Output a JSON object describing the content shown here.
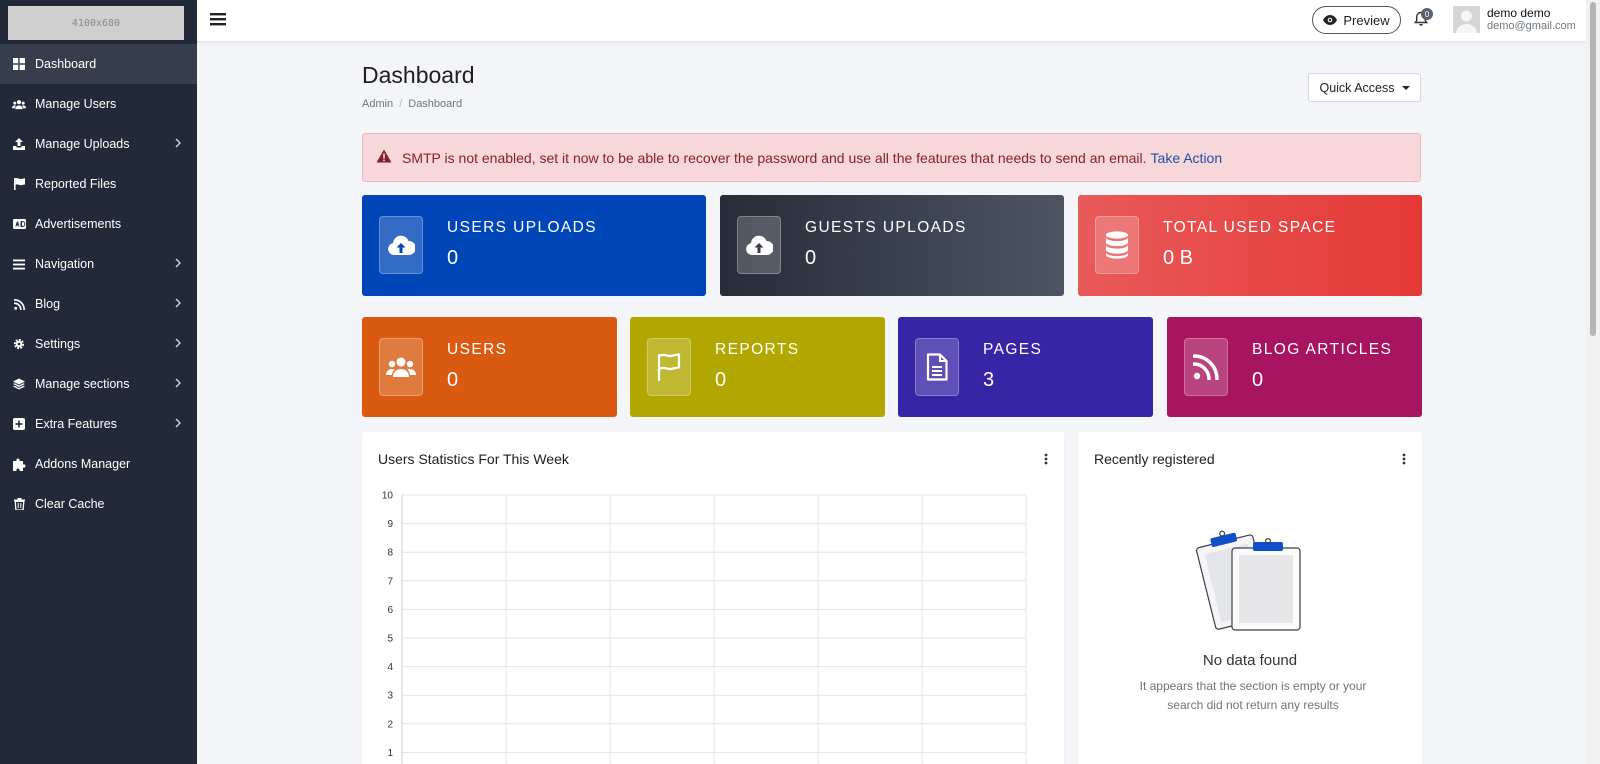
{
  "brand": {
    "logo_text": "4100x680"
  },
  "sidebar": {
    "items": [
      {
        "label": "Dashboard",
        "icon": "dashboard-icon",
        "chevron": false,
        "active": true
      },
      {
        "label": "Manage Users",
        "icon": "users-icon",
        "chevron": false
      },
      {
        "label": "Manage Uploads",
        "icon": "upload-icon",
        "chevron": true
      },
      {
        "label": "Reported Files",
        "icon": "flag-icon",
        "chevron": false
      },
      {
        "label": "Advertisements",
        "icon": "ad-icon",
        "chevron": false
      },
      {
        "label": "Navigation",
        "icon": "bars-icon",
        "chevron": true
      },
      {
        "label": "Blog",
        "icon": "rss-icon",
        "chevron": true
      },
      {
        "label": "Settings",
        "icon": "gear-icon",
        "chevron": true
      },
      {
        "label": "Manage sections",
        "icon": "layers-icon",
        "chevron": true
      },
      {
        "label": "Extra Features",
        "icon": "plus-square-icon",
        "chevron": true
      },
      {
        "label": "Addons Manager",
        "icon": "puzzle-icon",
        "chevron": false
      },
      {
        "label": "Clear Cache",
        "icon": "trash-icon",
        "chevron": false
      }
    ]
  },
  "topbar": {
    "preview_label": "Preview",
    "notification_count": "0",
    "user_name": "demo demo",
    "user_email": "demo@gmail.com"
  },
  "page": {
    "title": "Dashboard",
    "breadcrumb": [
      "Admin",
      "Dashboard"
    ],
    "quick_access_label": "Quick Access"
  },
  "alert": {
    "message": "SMTP is not enabled, set it now to be able to recover the password and use all the features that needs to send an email.",
    "action_label": "Take Action"
  },
  "stats_row1": [
    {
      "label": "USERS UPLOADS",
      "value": "0",
      "icon": "cloud-upload-icon",
      "color": "#0046b8"
    },
    {
      "label": "GUESTS UPLOADS",
      "value": "0",
      "icon": "cloud-upload-icon",
      "color": "#2f3644"
    },
    {
      "label": "TOTAL USED SPACE",
      "value": "0 B",
      "icon": "database-icon",
      "color": "#e53935"
    }
  ],
  "stats_row2": [
    {
      "label": "USERS",
      "value": "0",
      "icon": "users-icon",
      "color": "#d95a10"
    },
    {
      "label": "REPORTS",
      "value": "0",
      "icon": "flag-outline-icon",
      "color": "#b1a700"
    },
    {
      "label": "PAGES",
      "value": "3",
      "icon": "file-text-icon",
      "color": "#3725a6"
    },
    {
      "label": "BLOG ARTICLES",
      "value": "0",
      "icon": "rss-icon",
      "color": "#a71560"
    }
  ],
  "users_stats_card": {
    "title": "Users Statistics For This Week"
  },
  "recent_card": {
    "title": "Recently registered",
    "empty_title": "No data found",
    "empty_text": "It appears that the section is empty or your search did not return any results"
  },
  "chart_data": {
    "type": "line",
    "title": "Users Statistics For This Week",
    "xlabel": "",
    "ylabel": "",
    "ylim": [
      0,
      10
    ],
    "y_ticks": [
      10,
      9,
      8,
      7,
      6,
      5,
      4,
      3,
      2,
      1
    ],
    "series": [],
    "grid": true
  }
}
